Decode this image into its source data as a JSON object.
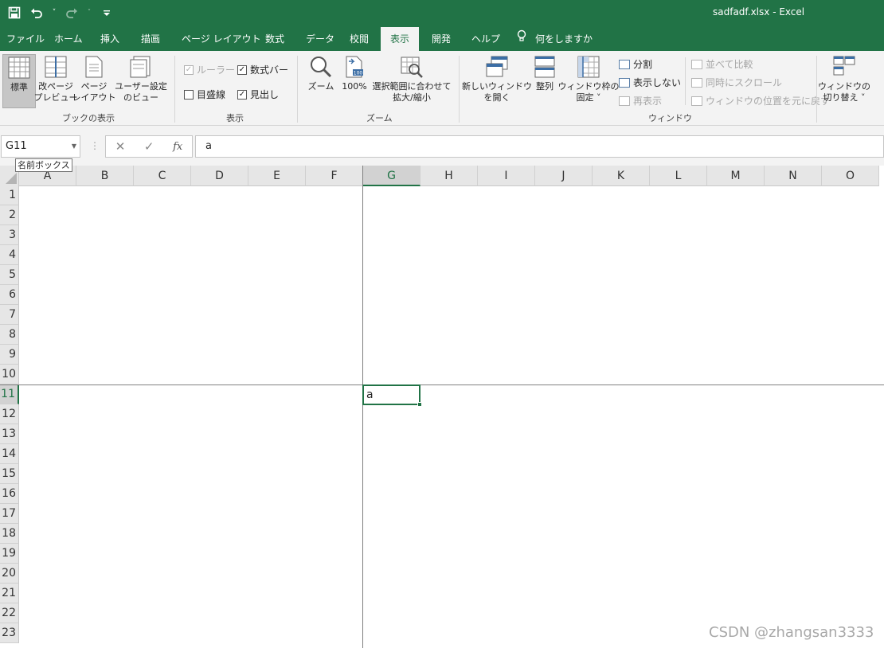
{
  "app": {
    "window_title": "sadfadf.xlsx  -  Excel",
    "qat": {
      "save_icon": "save-icon",
      "undo_icon": "undo-icon",
      "redo_icon": "redo-icon",
      "customize": "customize-qat-icon"
    }
  },
  "tabs": [
    {
      "label": "ファイル"
    },
    {
      "label": "ホーム"
    },
    {
      "label": "挿入"
    },
    {
      "label": "描画"
    },
    {
      "label": "ページ レイアウト"
    },
    {
      "label": "数式"
    },
    {
      "label": "データ"
    },
    {
      "label": "校閲"
    },
    {
      "label": "表示"
    },
    {
      "label": "開発"
    },
    {
      "label": "ヘルプ"
    }
  ],
  "tell_me": "何をしますか",
  "ribbon": {
    "groups": {
      "workbook_views": "ブックの表示",
      "show": "表示",
      "zoom": "ズーム",
      "window": "ウィンドウ"
    },
    "buttons": {
      "normal": "標準",
      "page_break_1": "改ページ",
      "page_break_2": "プレビュー",
      "page_layout_1": "ページ",
      "page_layout_2": "レイアウト",
      "custom_views_1": "ユーザー設定",
      "custom_views_2": "のビュー",
      "zoom": "ズーム",
      "zoom100": "100%",
      "zoom_selection_1": "選択範囲に合わせて",
      "zoom_selection_2": "拡大/縮小",
      "new_window_1": "新しいウィンドウ",
      "new_window_2": "を開く",
      "arrange_all": "整列",
      "freeze_panes_1": "ウィンドウ枠の",
      "freeze_panes_2": "固定 ˅",
      "split": "分割",
      "hide": "表示しない",
      "unhide": "再表示",
      "view_side_by_side": "並べて比較",
      "sync_scroll": "同時にスクロール",
      "reset_position": "ウィンドウの位置を元に戻す",
      "switch_windows_1": "ウィンドウの",
      "switch_windows_2": "切り替え ˅"
    },
    "checkboxes": {
      "ruler": {
        "label": "ルーラー",
        "checked": true,
        "enabled": false
      },
      "formula_bar": {
        "label": "数式バー",
        "checked": true,
        "enabled": true
      },
      "gridlines": {
        "label": "目盛線",
        "checked": false,
        "enabled": true
      },
      "headings": {
        "label": "見出し",
        "checked": true,
        "enabled": true
      }
    }
  },
  "formula_bar": {
    "name_box": "G11",
    "name_box_tooltip": "名前ボックス",
    "formula": "a"
  },
  "sheet": {
    "columns": [
      "A",
      "B",
      "C",
      "D",
      "E",
      "F",
      "G",
      "H",
      "I",
      "J",
      "K",
      "L",
      "M",
      "N",
      "O"
    ],
    "rows": [
      "1",
      "2",
      "3",
      "4",
      "5",
      "6",
      "7",
      "8",
      "9",
      "10",
      "11",
      "12",
      "13",
      "14",
      "15",
      "16",
      "17",
      "18",
      "19",
      "20",
      "21",
      "22",
      "23"
    ],
    "active_column": "G",
    "active_row": "11",
    "active_cell_value": "a"
  },
  "watermark": "CSDN @zhangsan3333",
  "colors": {
    "accent": "#217346",
    "ribbon_bg": "#f3f3f3"
  }
}
